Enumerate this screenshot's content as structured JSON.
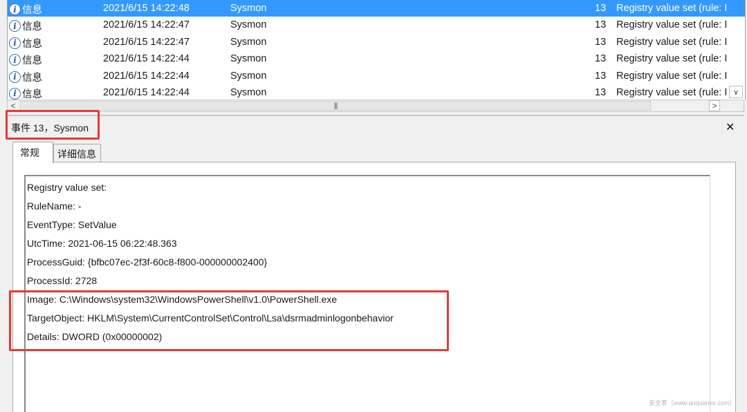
{
  "events": [
    {
      "level": "信息",
      "datetime": "2021/6/15 14:22:48",
      "source": "Sysmon",
      "event_id": "13",
      "task": "Registry value set (rule: I",
      "selected": true
    },
    {
      "level": "信息",
      "datetime": "2021/6/15 14:22:47",
      "source": "Sysmon",
      "event_id": "13",
      "task": "Registry value set (rule: I",
      "selected": false
    },
    {
      "level": "信息",
      "datetime": "2021/6/15 14:22:47",
      "source": "Sysmon",
      "event_id": "13",
      "task": "Registry value set (rule: I",
      "selected": false
    },
    {
      "level": "信息",
      "datetime": "2021/6/15 14:22:44",
      "source": "Sysmon",
      "event_id": "13",
      "task": "Registry value set (rule: I",
      "selected": false
    },
    {
      "level": "信息",
      "datetime": "2021/6/15 14:22:44",
      "source": "Sysmon",
      "event_id": "13",
      "task": "Registry value set (rule: I",
      "selected": false
    },
    {
      "level": "信息",
      "datetime": "2021/6/15 14:22:44",
      "source": "Sysmon",
      "event_id": "13",
      "task": "Registry value set (rule: I",
      "selected": false
    }
  ],
  "icons": {
    "info": "info-icon",
    "close": "close-icon",
    "scroll_left": "chevron-left-icon",
    "scroll_right": "chevron-right-icon",
    "scroll_down": "chevron-down-icon",
    "grip": "grip-icon"
  },
  "detail": {
    "title": "事件 13，Sysmon",
    "close_glyph": "✕",
    "tabs": {
      "general": "常规",
      "details": "详细信息"
    },
    "lines": [
      "Registry value set:",
      "RuleName: -",
      "EventType: SetValue",
      "UtcTime: 2021-06-15 06:22:48.363",
      "ProcessGuid: {bfbc07ec-2f3f-60c8-f800-000000002400}",
      "ProcessId: 2728",
      "Image: C:\\Windows\\system32\\WindowsPowerShell\\v1.0\\PowerShell.exe",
      "TargetObject: HKLM\\System\\CurrentControlSet\\Control\\Lsa\\dsrmadminlogonbehavior",
      "Details: DWORD (0x00000002)"
    ]
  },
  "scrollbar": {
    "left_glyph": "<",
    "right_glyph": ">",
    "down_glyph": "∨",
    "grip_glyph": "|||"
  },
  "watermark": "安全客（www.anquanke.com）",
  "colors": {
    "selection": "#3399ff",
    "highlight": "#e53935",
    "info_icon": "#2c5aa0"
  }
}
